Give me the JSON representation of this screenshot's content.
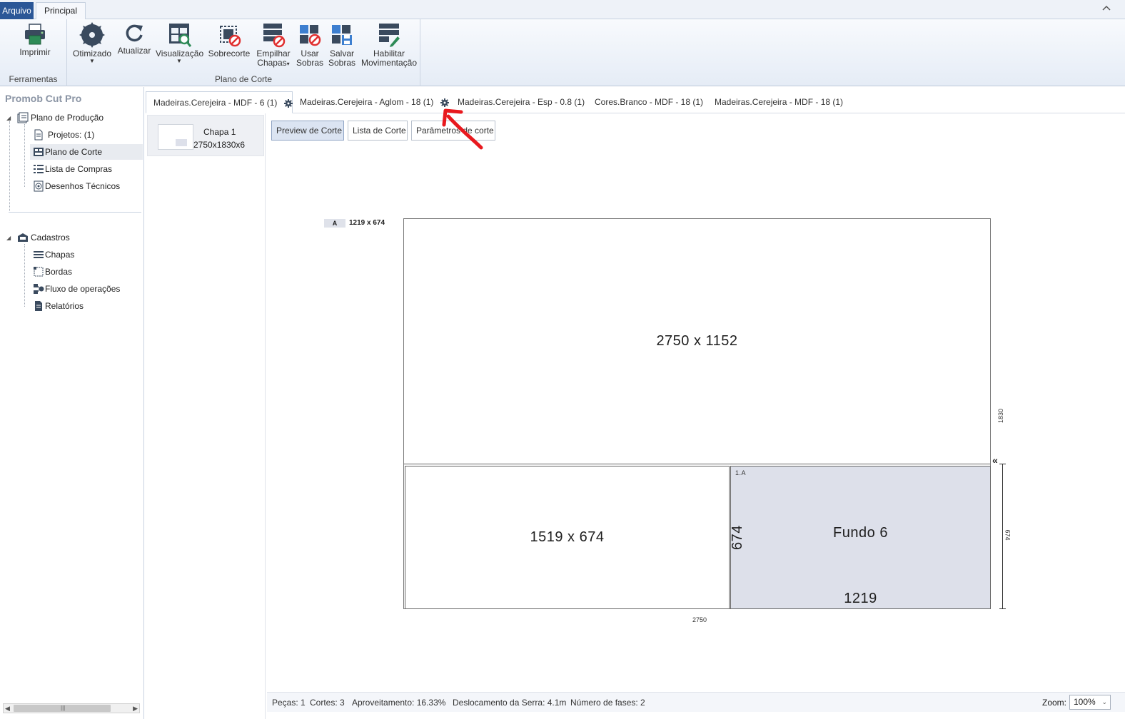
{
  "ribbon_tabs": {
    "arquivo": "Arquivo",
    "principal": "Principal"
  },
  "ribbon": {
    "ferramentas": {
      "label": "Ferramentas",
      "imprimir": "Imprimir"
    },
    "plano_de_corte": {
      "label": "Plano de Corte",
      "otimizado": "Otimizado",
      "atualizar": "Atualizar",
      "visualizacao": "Visualização",
      "sobrecorte": "Sobrecorte",
      "empilhar_1": "Empilhar",
      "empilhar_2": "Chapas",
      "usar_1": "Usar",
      "usar_2": "Sobras",
      "salvar_1": "Salvar",
      "salvar_2": "Sobras",
      "habilitar_1": "Habilitar",
      "habilitar_2": "Movimentação"
    }
  },
  "left_panel": {
    "title": "Promob Cut Pro",
    "plano_producao": "Plano de Produção",
    "projetos": "Projetos: (1)",
    "plano_corte": "Plano de Corte",
    "lista_compras": "Lista de Compras",
    "desenhos_tecnicos": "Desenhos Técnicos",
    "cadastros": "Cadastros",
    "chapas": "Chapas",
    "bordas": "Bordas",
    "fluxo_operacoes": "Fluxo de operações",
    "relatorios": "Relatórios"
  },
  "doc_tabs": [
    "Madeiras.Cerejeira - MDF - 6 (1)",
    "Madeiras.Cerejeira - Aglom - 18 (1)",
    "Madeiras.Cerejeira - Esp - 0.8 (1)",
    "Cores.Branco - MDF - 18 (1)",
    "Madeiras.Cerejeira - MDF - 18 (1)"
  ],
  "sheet_list": {
    "name": "Chapa 1",
    "dims": "2750x1830x6"
  },
  "view_buttons": {
    "preview": "Preview de Corte",
    "lista": "Lista de Corte",
    "parametros": "Parâmetros de corte"
  },
  "diagram": {
    "scrap_badge": "A",
    "scrap_dims": "1219 x 674",
    "piece_top": "2750 x 1152",
    "piece_bottom_left": "1519 x 674",
    "fundo_tag": "1.A",
    "fundo_name": "Fundo 6",
    "fundo_height": "674",
    "fundo_width": "1219",
    "dim_total_width": "2750",
    "dim_total_height": "1830",
    "dim_strip_height": "674"
  },
  "status": {
    "pecas": "Peças: 1",
    "cortes": "Cortes: 3",
    "aproveitamento": "Aproveitamento: 16.33%",
    "deslocamento": "Deslocamento da Serra: 4.1m",
    "fases": "Número de fases: 2",
    "zoom_label": "Zoom:",
    "zoom_value": "100%"
  },
  "colors": {
    "accent": "#2b5797",
    "piece_fill": "#dde0ea",
    "annotation": "#e8191e"
  }
}
